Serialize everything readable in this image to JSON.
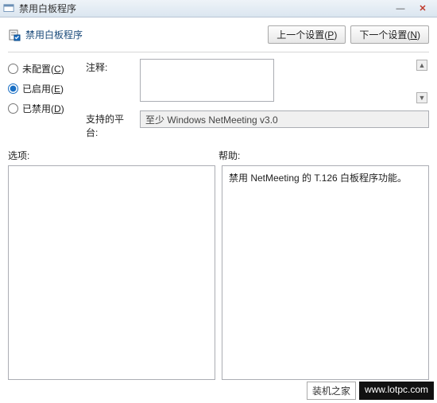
{
  "window": {
    "title": "禁用白板程序",
    "controls": {
      "min": "—",
      "close": "✕"
    }
  },
  "header": {
    "policy_title": "禁用白板程序"
  },
  "nav": {
    "prev": "上一个设置",
    "prev_key": "P",
    "next": "下一个设置",
    "next_key": "N"
  },
  "radios": {
    "not_configured": "未配置",
    "not_configured_key": "C",
    "enabled": "已启用",
    "enabled_key": "E",
    "disabled": "已禁用",
    "disabled_key": "D",
    "selected": "enabled"
  },
  "fields": {
    "comment_label": "注释:",
    "comment_value": "",
    "platform_label": "支持的平台:",
    "platform_value": "至少 Windows NetMeeting v3.0"
  },
  "sections": {
    "options_label": "选项:",
    "help_label": "帮助:",
    "options_text": "",
    "help_text": "禁用 NetMeeting 的 T.126 白板程序功能。"
  },
  "watermark": {
    "brand_cn": "装机之家",
    "brand_url": "www.lotpc.com"
  }
}
